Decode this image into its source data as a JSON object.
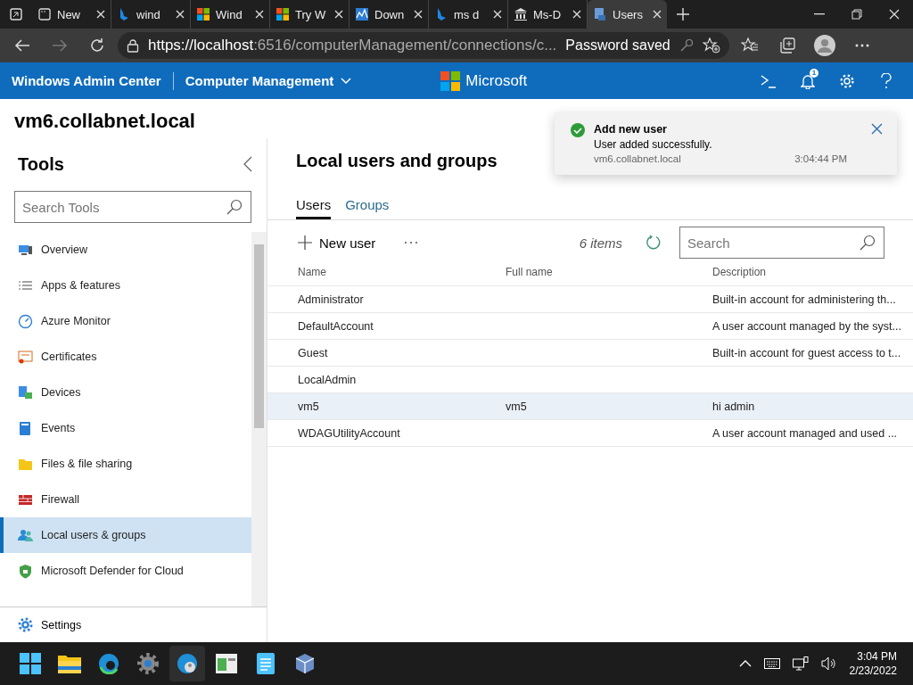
{
  "browser": {
    "tabs": [
      {
        "title": "New",
        "selected": false
      },
      {
        "title": "wind",
        "selected": false
      },
      {
        "title": "Wind",
        "selected": false
      },
      {
        "title": "Try W",
        "selected": false
      },
      {
        "title": "Down",
        "selected": false
      },
      {
        "title": "ms d",
        "selected": false
      },
      {
        "title": "Ms-D",
        "selected": false
      },
      {
        "title": "Users",
        "selected": true
      }
    ],
    "address": {
      "host": "https://localhost",
      "rest": ":6516/computerManagement/connections/c..."
    },
    "password_notice": "Password saved",
    "notification_count": "1"
  },
  "app_bar": {
    "product": "Windows Admin Center",
    "solution": "Computer Management",
    "brand": "Microsoft"
  },
  "host": "vm6.collabnet.local",
  "tools": {
    "title": "Tools",
    "search": {
      "placeholder": "Search Tools"
    },
    "items": [
      {
        "label": "Overview",
        "selected": false
      },
      {
        "label": "Apps & features",
        "selected": false
      },
      {
        "label": "Azure Monitor",
        "selected": false
      },
      {
        "label": "Certificates",
        "selected": false
      },
      {
        "label": "Devices",
        "selected": false
      },
      {
        "label": "Events",
        "selected": false
      },
      {
        "label": "Files & file sharing",
        "selected": false
      },
      {
        "label": "Firewall",
        "selected": false
      },
      {
        "label": "Local users & groups",
        "selected": true
      },
      {
        "label": "Microsoft Defender for Cloud",
        "selected": false
      }
    ],
    "settings": "Settings"
  },
  "page": {
    "title": "Local users and groups",
    "tabs": [
      {
        "label": "Users",
        "selected": true
      },
      {
        "label": "Groups",
        "selected": false
      }
    ],
    "toolbar": {
      "new_button": "New user",
      "count": "6 items",
      "search": {
        "placeholder": "Search"
      }
    },
    "table": {
      "columns": [
        "Name",
        "Full name",
        "Description"
      ],
      "rows": [
        {
          "cells": [
            "Administrator",
            "",
            "Built-in account for administering th..."
          ],
          "highlighted": false
        },
        {
          "cells": [
            "DefaultAccount",
            "",
            "A user account managed by the syst..."
          ],
          "highlighted": false
        },
        {
          "cells": [
            "Guest",
            "",
            "Built-in account for guest access to t..."
          ],
          "highlighted": false
        },
        {
          "cells": [
            "LocalAdmin",
            "",
            ""
          ],
          "highlighted": false
        },
        {
          "cells": [
            "vm5",
            "vm5",
            "hi admin"
          ],
          "highlighted": true
        },
        {
          "cells": [
            "WDAGUtilityAccount",
            "",
            "A user account managed and used ..."
          ],
          "highlighted": false
        }
      ]
    }
  },
  "toast": {
    "title": "Add new user",
    "message": "User added successfully.",
    "source": "vm6.collabnet.local",
    "time": "3:04:44 PM"
  },
  "taskbar": {
    "time": "3:04 PM",
    "date": "2/23/2022"
  }
}
